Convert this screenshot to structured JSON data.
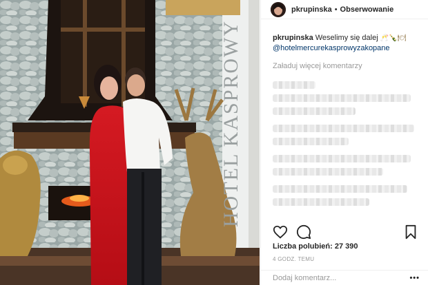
{
  "post": {
    "username": "pkrupinska",
    "separator": "•",
    "follow_label": "Obserwowanie",
    "caption_text": "Weselimy się dalej",
    "caption_emojis": "🥂🍾🍽",
    "caption_tag": "@hotelmercurekasprowyzakopane",
    "load_more_label": "Załaduj więcej komentarzy",
    "likes_label": "Liczba polubień: 27 390",
    "time_label": "4 GODZ. TEMU",
    "add_comment_placeholder": "Dodaj komentarz...",
    "more_options_label": "•••",
    "photo_sign_text": "HOTEL KASPROWY"
  },
  "icons": {
    "like": "heart-icon",
    "comment": "comment-bubble-icon",
    "save": "bookmark-icon"
  }
}
